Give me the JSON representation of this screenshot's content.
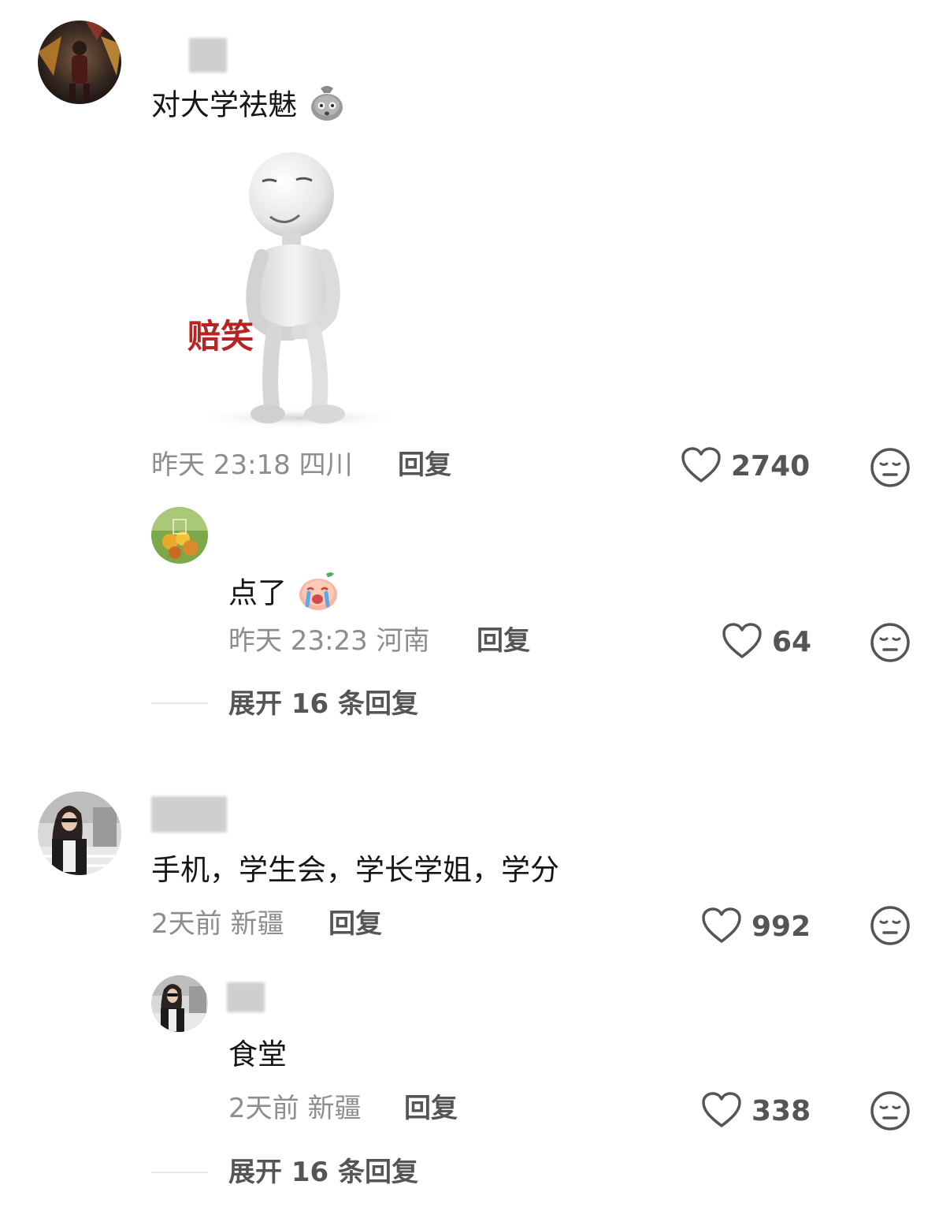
{
  "comments": [
    {
      "text": "对大学祛魅",
      "sticker_caption": "赔笑",
      "time": "昨天 23:18",
      "location": "四川",
      "reply_label": "回复",
      "likes": "2740",
      "reply": {
        "text": "点了",
        "time": "昨天 23:23",
        "location": "河南",
        "reply_label": "回复",
        "likes": "64"
      },
      "expand_label": "展开 16 条回复"
    },
    {
      "text": "手机，学生会，学长学姐，学分",
      "time": "2天前",
      "location": "新疆",
      "reply_label": "回复",
      "likes": "992",
      "reply": {
        "text": "食堂",
        "time": "2天前",
        "location": "新疆",
        "reply_label": "回复",
        "likes": "338"
      },
      "expand_label": "展开 16 条回复"
    }
  ],
  "colors": {
    "text": "#161616",
    "meta": "#8d8d8d",
    "action": "#555555",
    "sticker_caption": "#b82424"
  },
  "icons": [
    "heart-outline-icon",
    "dislike-face-icon",
    "money-bag-emoji",
    "crying-peach-emoji"
  ]
}
